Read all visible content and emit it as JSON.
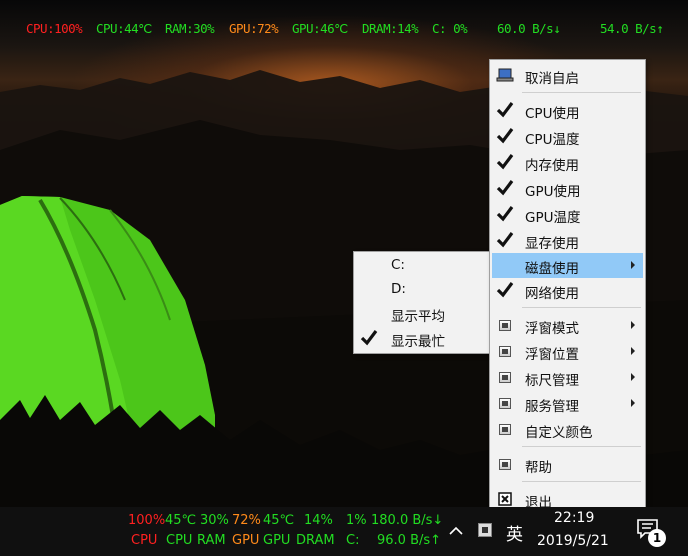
{
  "overlay": {
    "cpu_usage": "CPU:100%",
    "cpu_temp": "CPU:44℃",
    "ram": "RAM:30%",
    "gpu_usage": "GPU:72%",
    "gpu_temp": "GPU:46℃",
    "dram": "DRAM:14%",
    "disk": "C: 0%",
    "down": "60.0 B/s↓",
    "up": "54.0 B/s↑"
  },
  "colors": {
    "red": "#ff2020",
    "green": "#22dd22",
    "orange": "#ff8a1a",
    "menu_highlight": "#91c9f7"
  },
  "main_menu": {
    "items": [
      {
        "label": "取消自启",
        "icon": "laptop-icon"
      },
      {
        "label": "CPU使用",
        "icon": "check-icon"
      },
      {
        "label": "CPU温度",
        "icon": "check-icon"
      },
      {
        "label": "内存使用",
        "icon": "check-icon"
      },
      {
        "label": "GPU使用",
        "icon": "check-icon"
      },
      {
        "label": "GPU温度",
        "icon": "check-icon"
      },
      {
        "label": "显存使用",
        "icon": "check-icon"
      },
      {
        "label": "磁盘使用",
        "icon": "submenu-arrow-icon"
      },
      {
        "label": "网络使用",
        "icon": "check-icon"
      },
      {
        "label": "浮窗模式",
        "icon": "window-icon"
      },
      {
        "label": "浮窗位置",
        "icon": "window-icon"
      },
      {
        "label": "标尺管理",
        "icon": "window-icon"
      },
      {
        "label": "服务管理",
        "icon": "window-icon"
      },
      {
        "label": "自定义颜色",
        "icon": "window-icon"
      },
      {
        "label": "帮助",
        "icon": "window-icon"
      },
      {
        "label": "退出",
        "icon": "close-box-icon"
      }
    ]
  },
  "disk_submenu": {
    "items": [
      {
        "label": "C:"
      },
      {
        "label": "D:"
      },
      {
        "label": "显示平均"
      },
      {
        "label": "显示最忙",
        "checked": true
      }
    ]
  },
  "taskbar": {
    "mon_top": [
      "100%",
      "45℃",
      "30%",
      "72%",
      "45℃",
      "14%",
      "1%",
      "180.0 B/s↓"
    ],
    "mon_bottom": [
      "CPU",
      "CPU",
      "RAM",
      "GPU",
      "GPU",
      "DRAM",
      "C:",
      "96.0 B/s↑"
    ],
    "ime": "英",
    "time": "22:19",
    "date": "2019/5/21",
    "notification_count": "1"
  }
}
